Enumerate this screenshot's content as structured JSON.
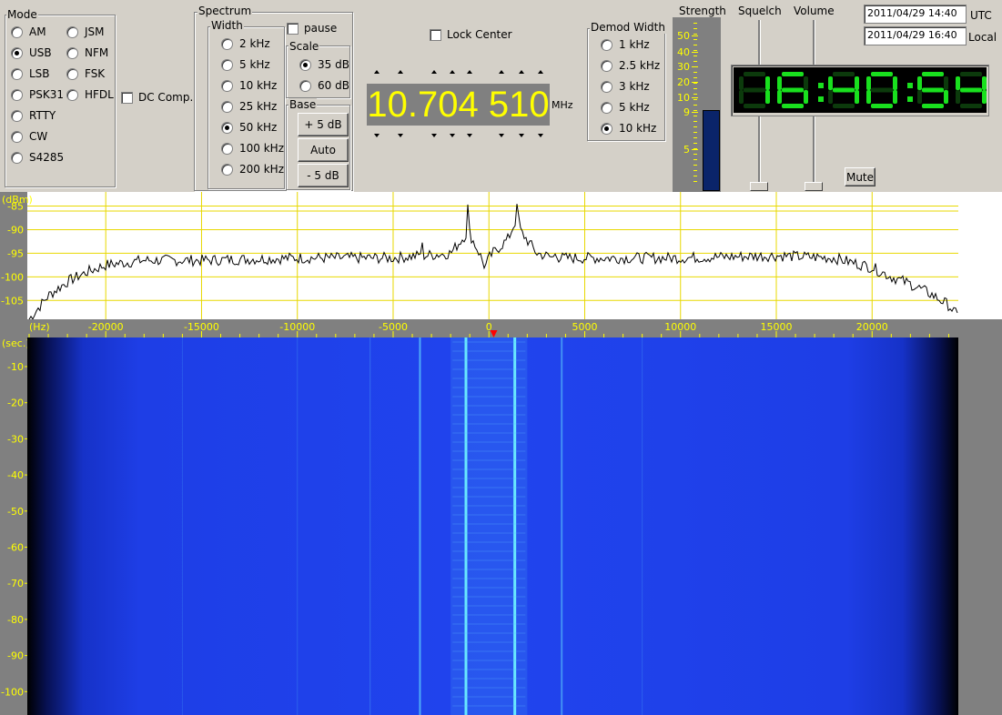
{
  "mode": {
    "title": "Mode",
    "items": [
      "AM",
      "USB",
      "LSB",
      "PSK31",
      "RTTY",
      "CW",
      "S4285"
    ],
    "items2": [
      "JSM",
      "NFM",
      "FSK",
      "HFDL"
    ],
    "selected": "USB",
    "dc_comp": "DC Comp."
  },
  "spectrum": {
    "title": "Spectrum",
    "width_title": "Width",
    "widths": [
      "2 kHz",
      "5 kHz",
      "10 kHz",
      "25 kHz",
      "50 kHz",
      "100 kHz",
      "200 kHz"
    ],
    "width_selected": "50 kHz",
    "pause": "pause",
    "scale_title": "Scale",
    "scales": [
      "35 dB",
      "60 dB"
    ],
    "scale_selected": "35 dB",
    "base_title": "Base",
    "base_plus": "+ 5 dB",
    "base_auto": "Auto",
    "base_minus": "- 5 dB"
  },
  "lock_center": "Lock Center",
  "frequency": {
    "value": "10.704 510",
    "unit": "MHz"
  },
  "demod": {
    "title": "Demod Width",
    "items": [
      "1 kHz",
      "2.5 kHz",
      "3 kHz",
      "5 kHz",
      "10 kHz"
    ],
    "selected": "10 kHz"
  },
  "strength": {
    "title": "Strength",
    "scale": [
      "50",
      "40",
      "30",
      "20",
      "10",
      "9",
      "5"
    ],
    "level_fraction": 0.47
  },
  "squelch_label": "Squelch",
  "volume_label": "Volume",
  "mute_label": "Mute",
  "dates": {
    "utc_value": "2011/04/29  14:40",
    "utc_label": "UTC",
    "local_value": "2011/04/29  16:40",
    "local_label": "Local"
  },
  "clock": "16:40:54",
  "colors": {
    "yellow": "#ffff00",
    "lcd_bg": "#808080",
    "clock_on": "#19e01e",
    "clock_off": "#0c3a0c",
    "waterfall": "#1e3ee6"
  },
  "chart_data": {
    "type": "line",
    "ylabel": "(dBm)",
    "y_ticks": [
      "-85",
      "-90",
      "-95",
      "-100",
      "-105"
    ],
    "ylim": [
      -109,
      -82
    ],
    "xlabel": "(Hz)",
    "x_ticks": [
      "-20000",
      "-15000",
      "-10000",
      "-5000",
      "0",
      "5000",
      "10000",
      "15000",
      "20000"
    ],
    "xlim": [
      -24000,
      24500
    ],
    "series": [
      {
        "x": [
          -24000,
          -23000,
          -22000,
          -21000,
          -20000,
          -19000,
          -18000,
          -15000,
          -10000,
          -5000,
          -3600,
          -3500,
          -3400,
          -2000,
          -1200,
          -1100,
          -1000,
          -500,
          -200,
          0,
          200,
          1000,
          1400,
          1500,
          1600,
          2500,
          3400,
          3500,
          3600,
          5000,
          10000,
          15000,
          18000,
          19000,
          20000,
          21000,
          22000,
          23000,
          24000,
          24500
        ],
        "y": [
          -109,
          -104,
          -101,
          -99,
          -97.5,
          -97,
          -96.5,
          -96.5,
          -96,
          -96,
          -95.5,
          -93,
          -95.5,
          -95,
          -91,
          -85,
          -91,
          -95,
          -98,
          -96,
          -95,
          -92,
          -88,
          -84,
          -90,
          -95,
          -96,
          -94,
          -96,
          -96,
          -96,
          -95.5,
          -96,
          -97,
          -98,
          -100,
          -101.5,
          -103.5,
          -106,
          -108.5
        ]
      }
    ]
  },
  "waterfall": {
    "ylabel": "(sec.)",
    "y_ticks": [
      "-10",
      "-20",
      "-30",
      "-40",
      "-50",
      "-60",
      "-70",
      "-80",
      "-90",
      "-100"
    ]
  }
}
